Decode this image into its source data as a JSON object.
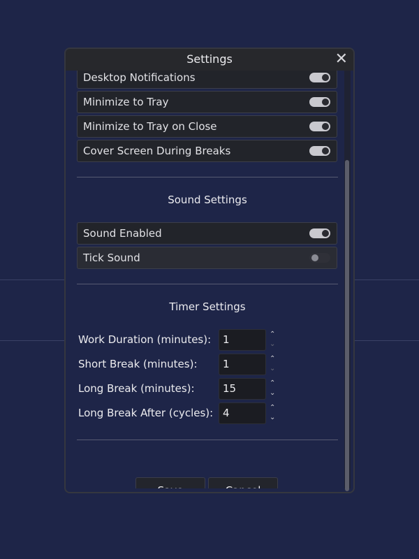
{
  "dialog": {
    "title": "Settings",
    "close_label": "✕"
  },
  "toggles": [
    {
      "label": "Desktop Notifications",
      "on": true
    },
    {
      "label": "Minimize to Tray",
      "on": true
    },
    {
      "label": "Minimize to Tray on Close",
      "on": true
    },
    {
      "label": "Cover Screen During Breaks",
      "on": true
    }
  ],
  "sound": {
    "title": "Sound Settings",
    "items": [
      {
        "label": "Sound Enabled",
        "on": true
      },
      {
        "label": "Tick Sound",
        "on": false
      }
    ]
  },
  "timer": {
    "title": "Timer Settings",
    "fields": [
      {
        "label": "Work Duration (minutes):",
        "value": "1"
      },
      {
        "label": "Short Break (minutes):",
        "value": "1"
      },
      {
        "label": "Long Break (minutes):",
        "value": "15"
      },
      {
        "label": "Long Break After (cycles):",
        "value": "4"
      }
    ]
  },
  "actions": {
    "save_label": "Save",
    "cancel_label": "Cancel"
  },
  "colors": {
    "background": "#1e2548",
    "panel": "#22242a",
    "titlebar": "#27282c",
    "toggle_on": "#c9c9cf"
  }
}
